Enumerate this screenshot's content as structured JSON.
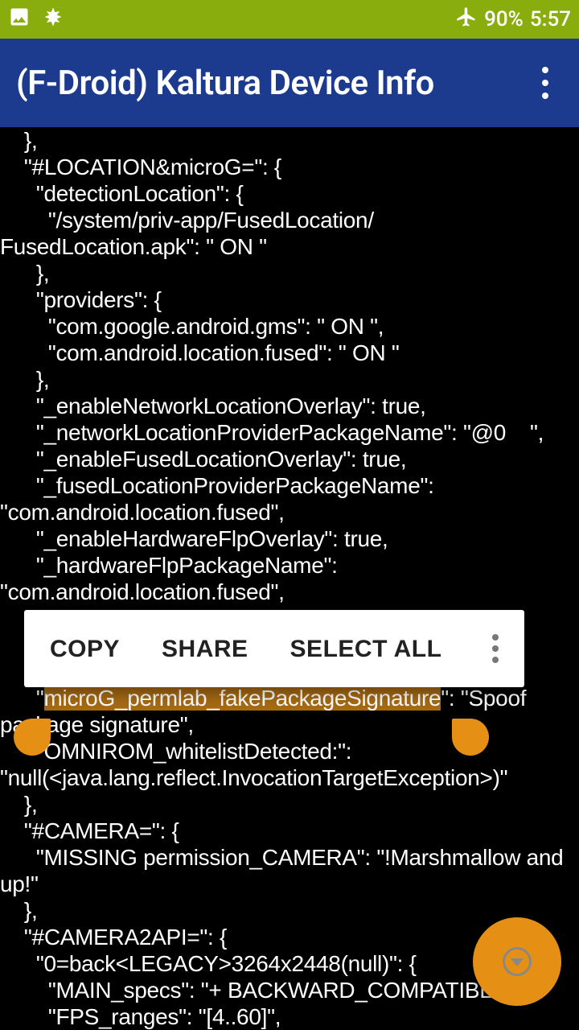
{
  "statusbar": {
    "battery": "90%",
    "clock": "5:57"
  },
  "appbar": {
    "title": "(F-Droid) Kaltura Device Info"
  },
  "popup": {
    "copy": "COPY",
    "share": "SHARE",
    "selectAll": "SELECT ALL"
  },
  "selection": {
    "text": "microG_permlab_fakePackageSignature"
  },
  "body": {
    "pre1": "    },\n    \"#LOCATION&microG=\": {\n      \"detectionLocation\": {\n        \"/system/priv-app/FusedLocation/\nFusedLocation.apk\": \" ON \"\n      },\n      \"providers\": {\n        \"com.google.android.gms\": \" ON \",\n        \"com.android.location.fused\": \" ON \"\n      },\n      \"_enableNetworkLocationOverlay\": true,\n      \"_networkLocationProviderPackageName\": \"@0    \",\n      \"_enableFusedLocationOverlay\": true,\n      \"_fusedLocationProviderPackageName\": \n\"com.android.location.fused\",\n      \"_enableHardwareFlpOverlay\": true,\n      \"_hardwareFlpPackageName\": \n\"com.android.location.fused\",\n      \"_enableGeocoderOverlay\": true,\n      \"_geocoderProviderPackageName\": \"@0    \",\n      \"_geofenceProviderPackageName\": \"@0    \",\n      \"",
    "pre2": "\": \"Spoof \npackage signature\",\n      \"OMNIROM_whitelistDetected:\": \n\"null(<java.lang.reflect.InvocationTargetException>)\"\n    },\n    \"#CAMERA=\": {\n      \"MISSING permission_CAMERA\": \"!Marshmallow and \nup!\"\n    },\n    \"#CAMERA2API=\": {\n      \"0=back<LEGACY>3264x2448(null)\": {\n        \"MAIN_specs\": \"+ BACKWARD_COMPATIBLE \",\n        \"FPS_ranges\": \"[4..60]\","
  }
}
